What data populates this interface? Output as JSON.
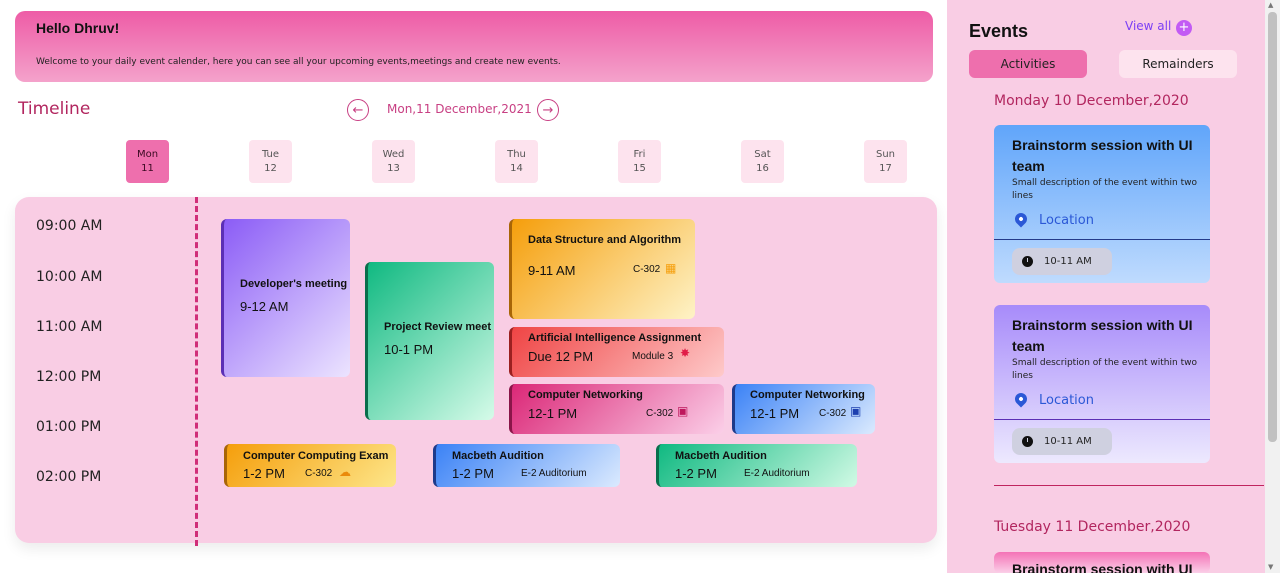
{
  "header": {
    "greeting": "Hello Dhruv!",
    "welcome": "Welcome to your daily event calender, here you can see all your upcoming events,meetings and create new events."
  },
  "timeline": {
    "title": "Timeline",
    "current_date": "Mon,11 December,2021",
    "prev_icon": "arrow-left-circle-icon",
    "next_icon": "arrow-right-circle-icon",
    "days": [
      {
        "name": "Mon",
        "num": "11",
        "active": true
      },
      {
        "name": "Tue",
        "num": "12"
      },
      {
        "name": "Wed",
        "num": "13"
      },
      {
        "name": "Thu",
        "num": "14"
      },
      {
        "name": "Fri",
        "num": "15"
      },
      {
        "name": "Sat",
        "num": "16"
      },
      {
        "name": "Sun",
        "num": "17"
      }
    ],
    "times": [
      "09:00 AM",
      "10:00 AM",
      "11:00 AM",
      "12:00 PM",
      "01:00 PM",
      "02:00 PM"
    ]
  },
  "events": [
    {
      "title": "Developer's meeting",
      "time": "9-12 AM",
      "room": "",
      "icon": ""
    },
    {
      "title": "Project Review meet",
      "time": "10-1 PM",
      "room": "",
      "icon": ""
    },
    {
      "title": "Data Structure and Algorithm",
      "time": "9-11 AM",
      "room": "C-302",
      "icon": "presentation-icon"
    },
    {
      "title": "Artificial Intelligence Assignment",
      "time": "Due 12 PM",
      "room": "Module 3",
      "icon": "bulb-icon"
    },
    {
      "title": "Computer Networking",
      "time": "12-1 PM",
      "room": "C-302",
      "icon": "monitor-icon"
    },
    {
      "title": "Computer Networking",
      "time": "12-1 PM",
      "room": "C-302",
      "icon": "monitor-icon"
    },
    {
      "title": "Computer Computing Exam",
      "time": "1-2 PM",
      "room": "C-302",
      "icon": "cloud-icon"
    },
    {
      "title": "Macbeth Audition",
      "time": "1-2 PM",
      "room": "E-2 Auditorium",
      "icon": ""
    },
    {
      "title": "Macbeth Audition",
      "time": "1-2 PM",
      "room": "E-2 Auditorium",
      "icon": ""
    }
  ],
  "sidebar": {
    "title": "Events",
    "view_all": "View all",
    "plus_icon": "plus-circle-icon",
    "tabs": {
      "activities": "Activities",
      "reminders": "Remainders"
    },
    "groups": [
      {
        "date": "Monday 10 December,2020",
        "cards": [
          {
            "title": "Brainstorm session with UI team",
            "desc": "Small description of the event within two lines",
            "location": "Location",
            "time": "10-11 AM"
          },
          {
            "title": "Brainstorm session with UI team",
            "desc": "Small description of the event within two lines",
            "location": "Location",
            "time": "10-11 AM"
          }
        ]
      },
      {
        "date": "Tuesday 11 December,2020",
        "cards": [
          {
            "title": "Brainstorm session with UI team"
          }
        ]
      }
    ]
  }
}
